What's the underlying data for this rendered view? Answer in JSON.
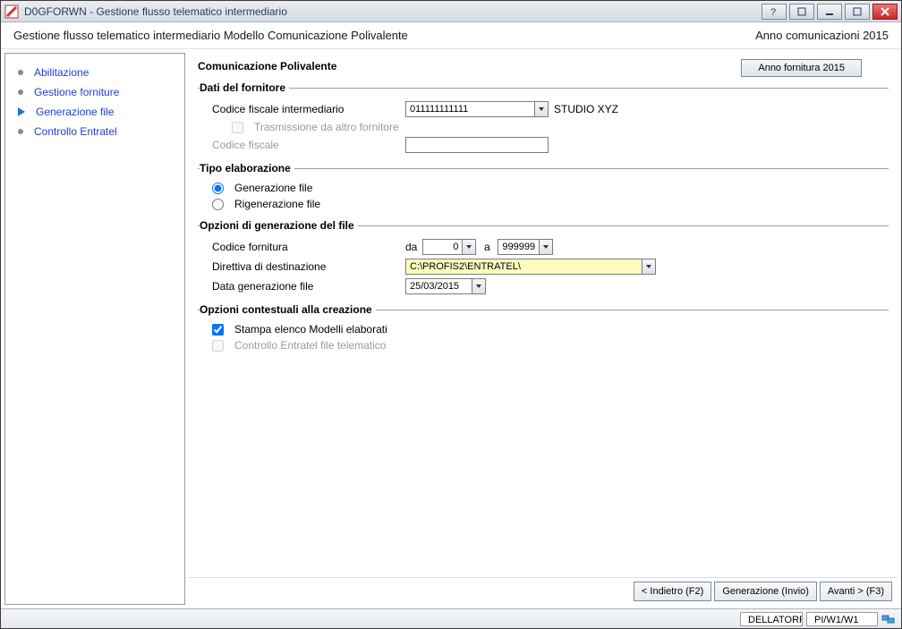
{
  "titlebar": {
    "app_code": "D0GFORWN",
    "title": "Gestione flusso telematico intermediario"
  },
  "subtitle": {
    "text": "Gestione flusso telematico intermediario Modello Comunicazione Polivalente",
    "right": "Anno comunicazioni 2015"
  },
  "wizard": {
    "items": [
      {
        "label": "Abilitazione"
      },
      {
        "label": "Gestione forniture"
      },
      {
        "label": "Generazione file"
      },
      {
        "label": "Controllo Entratel"
      }
    ],
    "active_index": 2
  },
  "form": {
    "section_title": "Comunicazione Polivalente",
    "anno_button": "Anno fornitura 2015",
    "group_provider": {
      "legend": "Dati del fornitore",
      "label_cf_inter": "Codice fiscale intermediario",
      "cf_inter_value": "011111111111",
      "cf_inter_name": "STUDIO XYZ",
      "label_trasm": "Trasmissione da altro fornitore",
      "label_cf": "Codice fiscale",
      "cf_value": ""
    },
    "group_elab": {
      "legend": "Tipo elaborazione",
      "opt1": "Generazione file",
      "opt2": "Rigenerazione file"
    },
    "group_gen": {
      "legend": "Opzioni di generazione del file",
      "label_codice": "Codice fornitura",
      "label_da": "da",
      "val_da": "0",
      "label_a": "a",
      "val_a": "999999",
      "label_dir": "Direttiva di destinazione",
      "val_dir": "C:\\PROFIS2\\ENTRATEL\\",
      "label_date": "Data generazione file",
      "val_date": "25/03/2015"
    },
    "group_ctx": {
      "legend": "Opzioni contestuali alla creazione",
      "opt_stamp": "Stampa elenco Modelli elaborati",
      "opt_ctrl": "Controllo Entratel file telematico"
    }
  },
  "buttons": {
    "back": "< Indietro (F2)",
    "gen": "Generazione (Invio)",
    "next": "Avanti > (F3)"
  },
  "statusbar": {
    "cell1": "DELLATORR",
    "cell2": "PI/W1/W1"
  }
}
